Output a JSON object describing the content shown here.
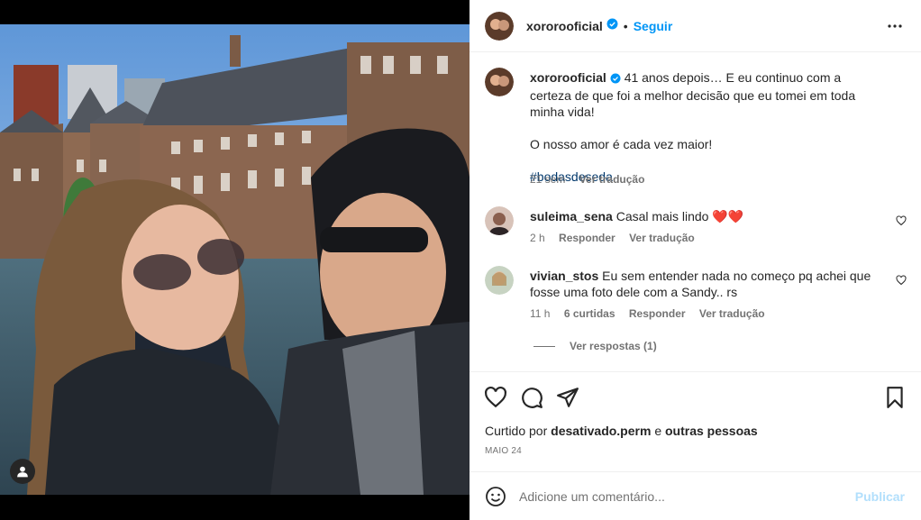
{
  "post": {
    "username": "xororooficial",
    "separator": "•",
    "follow_label": "Seguir",
    "more_icon": "more-options-icon",
    "verified_icon": "verified-badge-icon"
  },
  "caption": {
    "username": "xororooficial",
    "line1": "41 anos depois… E eu continuo com a certeza de que foi a melhor decisão que eu tomei em toda minha vida!",
    "line2": "O nosso amor é cada vez maior!",
    "hashtag": "#bodasdeseda",
    "time": "21 sem",
    "translate": "Ver tradução"
  },
  "comments": [
    {
      "username": "suleima_sena",
      "text": "Casal mais lindo",
      "emoji": "❤️❤️",
      "time": "2 h",
      "reply": "Responder",
      "translate": "Ver tradução"
    },
    {
      "username": "vivian_stos",
      "text": "Eu sem entender nada no começo pq achei que fosse uma foto dele com a Sandy.. rs",
      "time": "11 h",
      "likes": "6 curtidas",
      "reply": "Responder",
      "translate": "Ver tradução",
      "view_replies": "Ver respostas (1)"
    }
  ],
  "actions": {
    "like_icon": "heart-icon",
    "comment_icon": "comment-icon",
    "share_icon": "share-icon",
    "save_icon": "bookmark-icon"
  },
  "likes": {
    "prefix": "Curtido por",
    "user": "desativado.perm",
    "conj": "e",
    "others": "outras pessoas"
  },
  "date": "MAIO 24",
  "add_comment": {
    "placeholder": "Adicione um comentário...",
    "publish_label": "Publicar"
  },
  "colors": {
    "accent": "#0095f6",
    "publish_disabled": "#b2dffc",
    "secondary_text": "#737373",
    "like_heart": "#ed4956"
  }
}
